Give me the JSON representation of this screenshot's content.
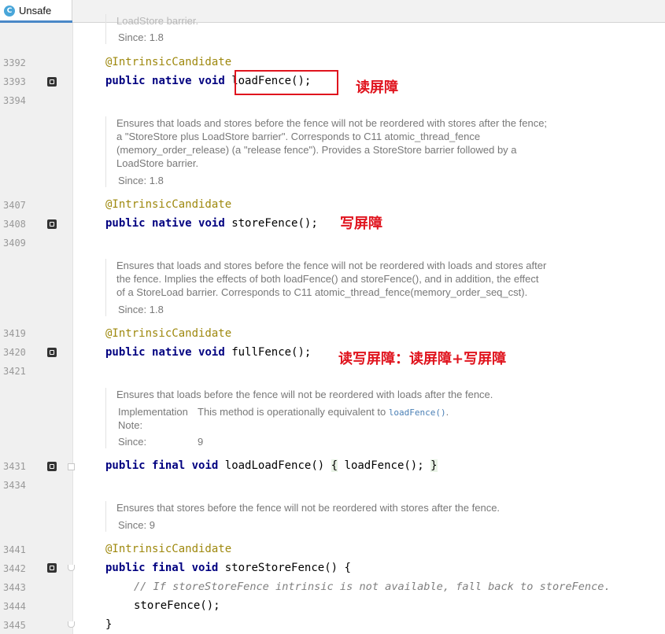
{
  "tab": {
    "icon": "C",
    "label": "Unsafe"
  },
  "doc0": {
    "partial": "LoadStore barrier.",
    "since": "Since: 1.8"
  },
  "line_numbers": [
    "3392",
    "3393",
    "3394",
    "3407",
    "3408",
    "3409",
    "3419",
    "3420",
    "3421",
    "3431",
    "3434",
    "3441",
    "3442",
    "3443",
    "3444",
    "3445"
  ],
  "annotation": "@IntrinsicCandidate",
  "keywords": {
    "public": "public",
    "native": "native",
    "final": "final",
    "void": "void"
  },
  "load_fence": {
    "method": "loadFence();",
    "note": "读屏障"
  },
  "doc1": {
    "lines": [
      "Ensures that loads and stores before the fence will not be reordered with stores after the fence;",
      "a \"StoreStore plus LoadStore barrier\". Corresponds to C11 atomic_thread_fence",
      "(memory_order_release) (a \"release fence\"). Provides a StoreStore barrier followed by a",
      "LoadStore barrier."
    ],
    "since": "Since: 1.8"
  },
  "store_fence": {
    "method": "storeFence();",
    "note": "写屏障"
  },
  "doc2": {
    "lines": [
      "Ensures that loads and stores before the fence will not be reordered with loads and stores after",
      "the fence. Implies the effects of both loadFence() and storeFence(), and in addition, the effect",
      "of a StoreLoad barrier. Corresponds to C11 atomic_thread_fence(memory_order_seq_cst)."
    ],
    "since": "Since: 1.8"
  },
  "full_fence": {
    "method": "fullFence();",
    "note": "读写屏障：读屏障+写屏障"
  },
  "doc3": {
    "line": "Ensures that loads before the fence will not be reordered with loads after the fence.",
    "impl_label": "Implementation",
    "impl_label2": "Note:",
    "impl_text": "This method is operationally equivalent to ",
    "impl_link": "loadFence()",
    "impl_end": ".",
    "since_label": "Since:",
    "since_value": "9"
  },
  "load_load_fence": {
    "method": "loadLoadFence()",
    "open": "{",
    "body": "loadFence();",
    "close": "}"
  },
  "doc4": {
    "line": "Ensures that stores before the fence will not be reordered with stores after the fence.",
    "since": "Since: 9"
  },
  "store_store_fence": {
    "method": "storeStoreFence() {",
    "comment": "// If storeStoreFence intrinsic is not available, fall back to storeFence.",
    "body": "storeFence();",
    "close": "}"
  }
}
